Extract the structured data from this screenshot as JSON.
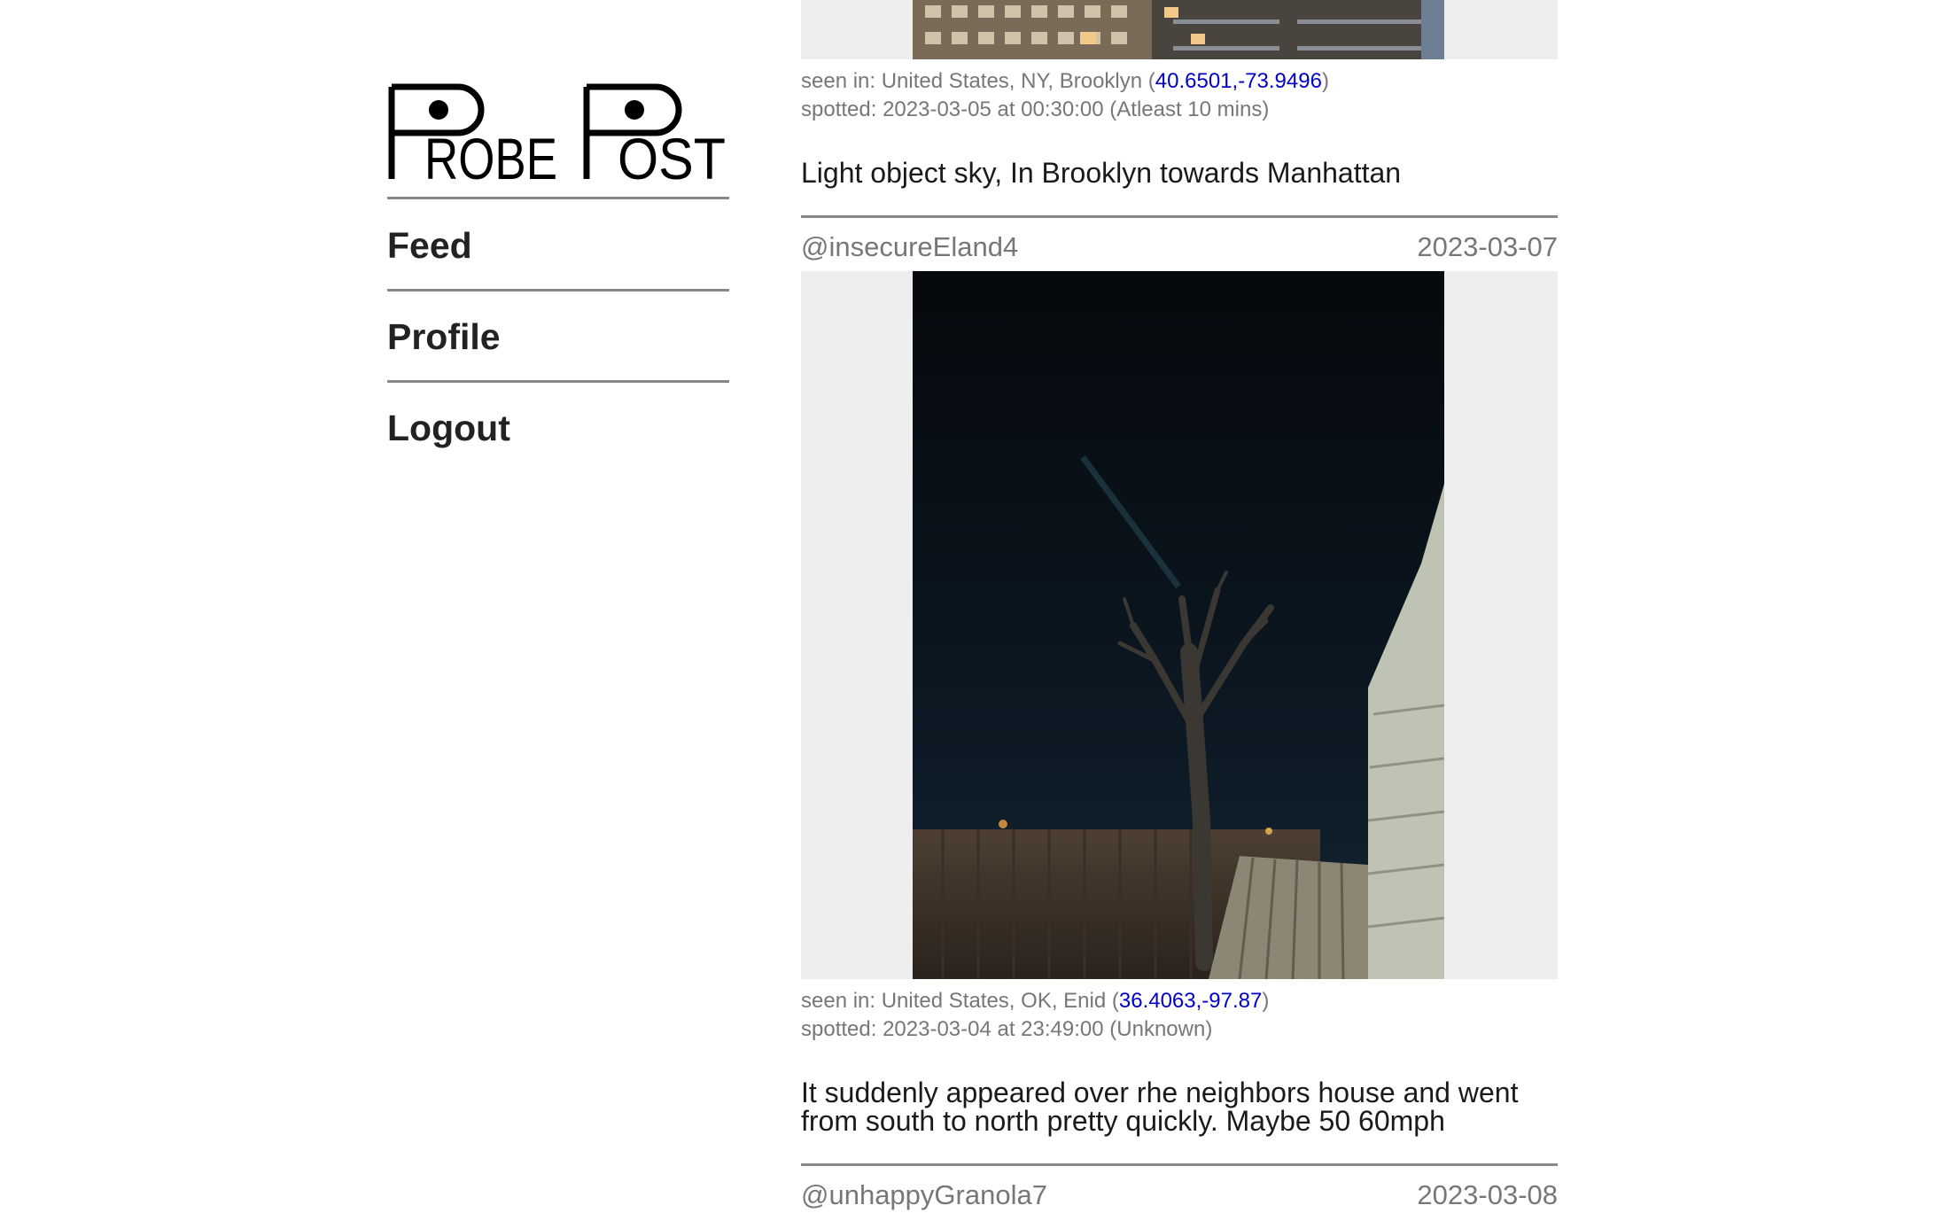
{
  "app": {
    "logo_text": "PROBEPOST"
  },
  "nav": {
    "items": [
      {
        "label": "Feed"
      },
      {
        "label": "Profile"
      },
      {
        "label": "Logout"
      }
    ]
  },
  "posts": [
    {
      "location_prefix": "seen in: United States, NY, Brooklyn (",
      "coords": "40.6501,-73.9496",
      "location_suffix": ")",
      "spotted": "spotted: 2023-03-05 at 00:30:00 (Atleast 10 mins)",
      "description": "Light object sky, In Brooklyn towards Manhattan"
    },
    {
      "user": "@insecureEland4",
      "date": "2023-03-07",
      "location_prefix": "seen in: United States, OK, Enid (",
      "coords": "36.4063,-97.87",
      "location_suffix": ")",
      "spotted": "spotted: 2023-03-04 at 23:49:00 (Unknown)",
      "description": "It suddenly appeared over rhe neighbors house and went from south to north pretty quickly. Maybe 50 60mph"
    },
    {
      "user": "@unhappyGranola7",
      "date": "2023-03-08"
    }
  ],
  "colors": {
    "link": "#0000cc",
    "meta_text": "#777777",
    "divider": "#888888",
    "image_frame_bg": "#eeeeee"
  }
}
